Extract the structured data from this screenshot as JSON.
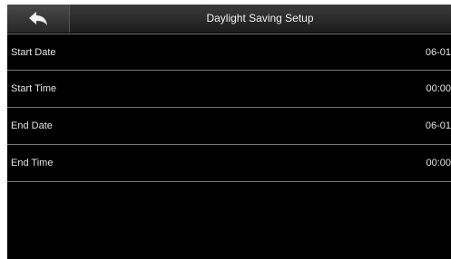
{
  "header": {
    "title": "Daylight Saving Setup",
    "back_icon": "back-arrow-icon"
  },
  "settings": [
    {
      "label": "Start Date",
      "value": "06-01"
    },
    {
      "label": "Start Time",
      "value": "00:00"
    },
    {
      "label": "End Date",
      "value": "06-01"
    },
    {
      "label": "End Time",
      "value": "00:00"
    }
  ],
  "colors": {
    "background": "#000000",
    "text": "#e6e6e6",
    "divider": "#777777"
  }
}
